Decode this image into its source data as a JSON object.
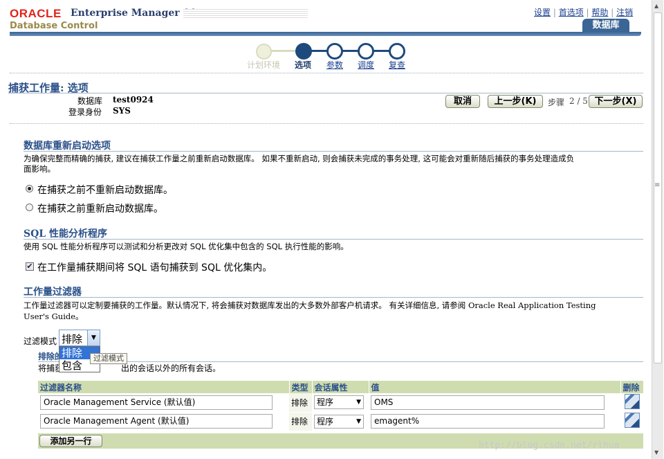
{
  "header": {
    "brand": "ORACLE",
    "product": "Enterprise Manager 11",
    "product_g": "g",
    "subtitle": "Database Control",
    "links": [
      "设置",
      "首选项",
      "帮助",
      "注销"
    ],
    "tab": "数据库"
  },
  "train": {
    "steps": [
      "计划环境",
      "选项",
      "参数",
      "调度",
      "复查"
    ],
    "current": 1
  },
  "page": {
    "title": "捕获工作量: 选项",
    "db_label": "数据库",
    "db_value": "test0924",
    "login_label": "登录身份",
    "login_value": "SYS",
    "cancel": "取消",
    "back": "上一步(K)",
    "step_label": "步骤",
    "step_value": "2 / 5",
    "next": "下一步(X)"
  },
  "restart": {
    "heading": "数据库重新启动选项",
    "desc1": "为确保完整而精确的捕获, 建议在捕获工作量之前重新启动数据库。 如果不重新启动, 则会捕获未完成的事务处理, 这可能会对重新随后捕获的事务处理造成负",
    "desc2": "面影响。",
    "opt1": "在捕获之前不重新启动数据库。",
    "opt2": "在捕获之前重新启动数据库。"
  },
  "spa": {
    "heading": "SQL 性能分析程序",
    "desc": "使用  SQL 性能分析程序可以测试和分析更改对  SQL 优化集中包含的  SQL 执行性能的影响。",
    "check": "在工作量捕获期间将  SQL 语句捕获到  SQL 优化集内。"
  },
  "filter": {
    "heading": "工作量过滤器",
    "desc1": "工作量过滤器可以定制要捕获的工作量。默认情况下, 将会捕获对数据库发出的大多数外部客户机请求。 有关详细信息, 请参阅",
    "desc_ref": "Oracle Real Application Testing",
    "desc2": "User's Guide。",
    "mode_label": "过滤模式",
    "mode_value": "排除",
    "options": [
      "排除",
      "包含"
    ],
    "tooltip": "过滤模式",
    "sub_heading": "排除的会话",
    "sub_desc_a": "将捕获",
    "sub_desc_b": "出的会话以外的所有会话。",
    "columns": [
      "过滤器名称",
      "类型",
      "会话属性",
      "值",
      "删除"
    ],
    "rows": [
      {
        "name": "Oracle Management Service (默认值)",
        "type": "排除",
        "attr": "程序",
        "value": "OMS"
      },
      {
        "name": "Oracle Management Agent (默认值)",
        "type": "排除",
        "attr": "程序",
        "value": "emagent%"
      }
    ],
    "add_button": "添加另一行"
  },
  "watermark": "http://blog.csdn.net/rlhua"
}
